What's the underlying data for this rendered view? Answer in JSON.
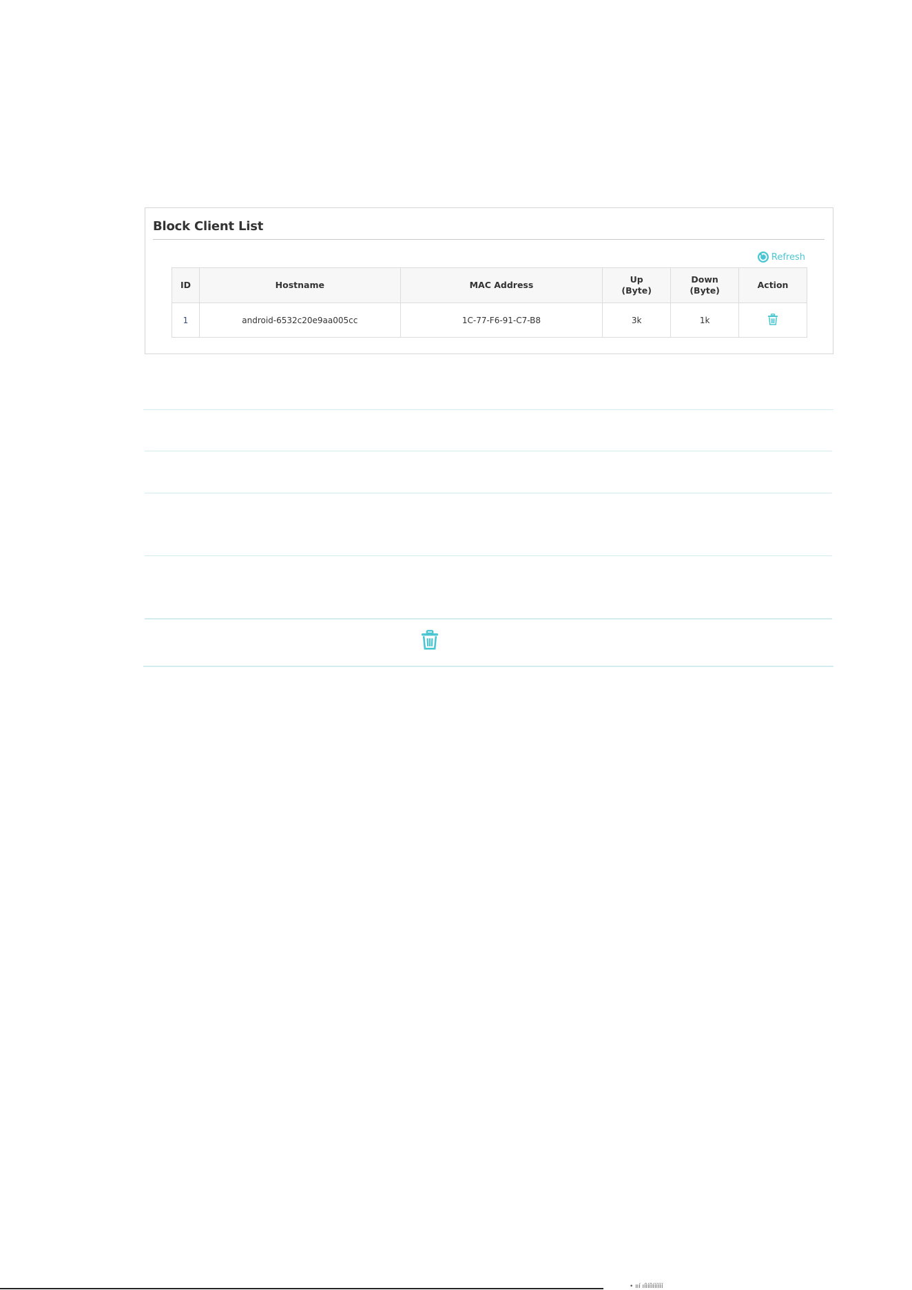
{
  "panel": {
    "title": "Block Client List",
    "refresh_label": "Refresh"
  },
  "table": {
    "columns": [
      {
        "label": "ID"
      },
      {
        "label": "Hostname"
      },
      {
        "label": "MAC Address"
      },
      {
        "label": "Up",
        "sub": "(Byte)"
      },
      {
        "label": "Down",
        "sub": "(Byte)"
      },
      {
        "label": "Action"
      }
    ],
    "rows": [
      {
        "id": "1",
        "hostname": "android-6532c20e9aa005cc",
        "mac": "1C-77-F6-91-C7-B8",
        "up": "3k",
        "down": "1k"
      }
    ]
  },
  "icons": {
    "refresh": "refresh-icon",
    "delete": "trash-icon"
  },
  "colors": {
    "accent": "#4ac6d2",
    "rule": "#d2ecef"
  },
  "footer": {
    "text": "• ııí ıíìííìíííííí"
  }
}
